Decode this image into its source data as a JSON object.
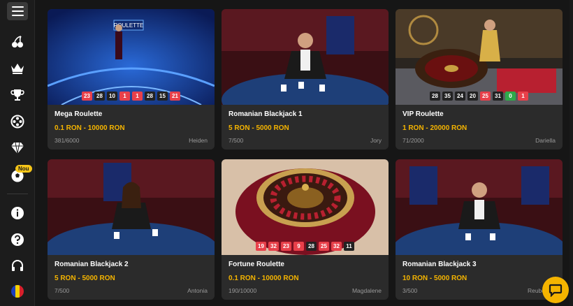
{
  "sidebar": {
    "new_badge": "Nou",
    "icons": [
      "menu-icon",
      "cherries-icon",
      "crown-icon",
      "trophy-icon",
      "film-reel-icon",
      "diamond-icon",
      "soccer-ball-icon",
      "info-icon",
      "help-icon",
      "headset-icon",
      "romania-flag-icon"
    ]
  },
  "cards": [
    {
      "title": "Mega Roulette",
      "limits": "0.1 RON - 10000 RON",
      "seats": "381/6000",
      "dealer": "Heiden",
      "results": [
        [
          "23",
          "red"
        ],
        [
          "28",
          "black"
        ],
        [
          "10",
          "black"
        ],
        [
          "1",
          "red"
        ],
        [
          "1",
          "red"
        ],
        [
          "28",
          "black"
        ],
        [
          "15",
          "black"
        ],
        [
          "21",
          "red"
        ]
      ]
    },
    {
      "title": "Romanian Blackjack 1",
      "limits": "5 RON - 5000 RON",
      "seats": "7/500",
      "dealer": "Jory",
      "results": []
    },
    {
      "title": "VIP Roulette",
      "limits": "1 RON - 20000 RON",
      "seats": "71/2000",
      "dealer": "Dariella",
      "results": [
        [
          "28",
          "black"
        ],
        [
          "35",
          "black"
        ],
        [
          "24",
          "black"
        ],
        [
          "20",
          "black"
        ],
        [
          "25",
          "red"
        ],
        [
          "31",
          "black"
        ],
        [
          "0",
          "green"
        ],
        [
          "1",
          "red"
        ]
      ]
    },
    {
      "title": "Romanian Blackjack 2",
      "limits": "5 RON - 5000 RON",
      "seats": "7/500",
      "dealer": "Antonia",
      "results": []
    },
    {
      "title": "Fortune Roulette",
      "limits": "0.1 RON - 10000 RON",
      "seats": "190/10000",
      "dealer": "Magdalene",
      "results": [
        [
          "19",
          "red"
        ],
        [
          "32",
          "red"
        ],
        [
          "23",
          "red"
        ],
        [
          "9",
          "red"
        ],
        [
          "28",
          "black"
        ],
        [
          "25",
          "red"
        ],
        [
          "32",
          "red"
        ],
        [
          "11",
          "black"
        ]
      ]
    },
    {
      "title": "Romanian Blackjack 3",
      "limits": "10 RON - 5000 RON",
      "seats": "3/500",
      "dealer": "Reuben-Vi",
      "results": []
    }
  ],
  "colors": {
    "accent": "#f5b400",
    "red": "#e8404a",
    "green": "#2fa84a"
  }
}
